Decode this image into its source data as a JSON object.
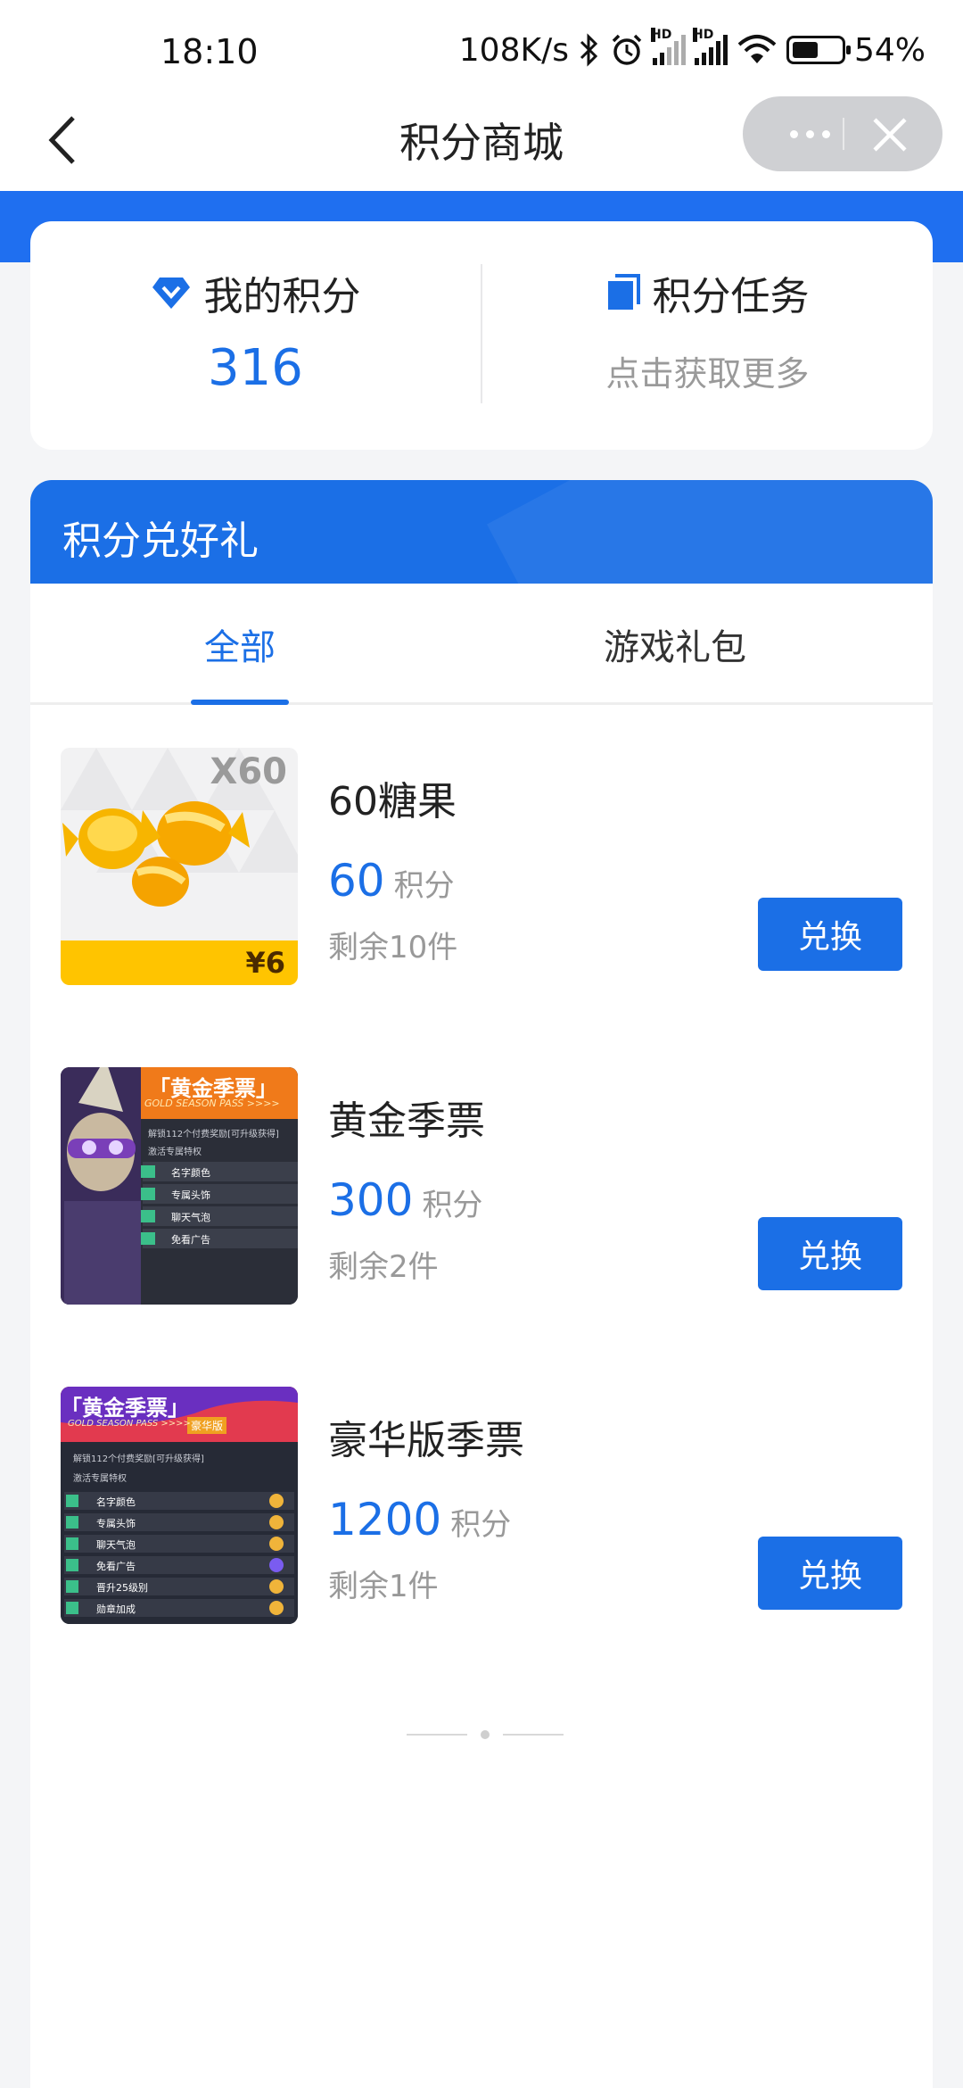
{
  "status_bar": {
    "time": "18:10",
    "network_speed": "108K/s",
    "battery": "54%",
    "icons": [
      "bluetooth-icon",
      "alarm-icon",
      "signal-hd-icon",
      "signal-hd-icon",
      "wifi-icon",
      "battery-icon"
    ],
    "hd_label": "HD",
    "battery_level": 0.54
  },
  "nav": {
    "title": "积分商城",
    "icons": [
      "back-arrow-icon",
      "more-dots-icon",
      "close-icon"
    ]
  },
  "points": {
    "my_points_label": "我的积分",
    "my_points_value": "316",
    "task_label": "积分任务",
    "task_sub": "点击获取更多",
    "icons": [
      "diamond-icon",
      "task-list-icon"
    ]
  },
  "exchange": {
    "header_title": "积分兑好礼",
    "tabs": [
      {
        "label": "全部",
        "active": true
      },
      {
        "label": "游戏礼包",
        "active": false
      }
    ],
    "products": [
      {
        "name": "60糖果",
        "price": "60",
        "unit": "积分",
        "stock": "剩余10件",
        "button": "兑换",
        "thumb_badge": "X60",
        "thumb_price": "¥6"
      },
      {
        "name": "黄金季票",
        "price": "300",
        "unit": "积分",
        "stock": "剩余2件",
        "button": "兑换",
        "thumb_title": "「黄金季票」",
        "thumb_sub": "GOLD SEASON PASS >>>>",
        "thumb_unlock": "解锁112个付费奖励[可升级获得]",
        "thumb_perks": "激活专属特权",
        "thumb_items": [
          "名字颜色",
          "专属头饰",
          "聊天气泡",
          "免看广告"
        ]
      },
      {
        "name": "豪华版季票",
        "price": "1200",
        "unit": "积分",
        "stock": "剩余1件",
        "button": "兑换",
        "thumb_title": "「黄金季票」",
        "thumb_tag": "豪华版",
        "thumb_sub": "GOLD SEASON PASS >>>>",
        "thumb_unlock": "解锁112个付费奖励[可升级获得]",
        "thumb_perks": "激活专属特权",
        "thumb_items": [
          "名字颜色",
          "专属头饰",
          "聊天气泡",
          "免看广告",
          "晋升25级别",
          "勋章加成"
        ]
      }
    ]
  },
  "colors": {
    "primary": "#1b6fe6",
    "header_blue": "#1f6ff0",
    "page_bg": "#f4f5f7",
    "muted_text": "#999999"
  }
}
